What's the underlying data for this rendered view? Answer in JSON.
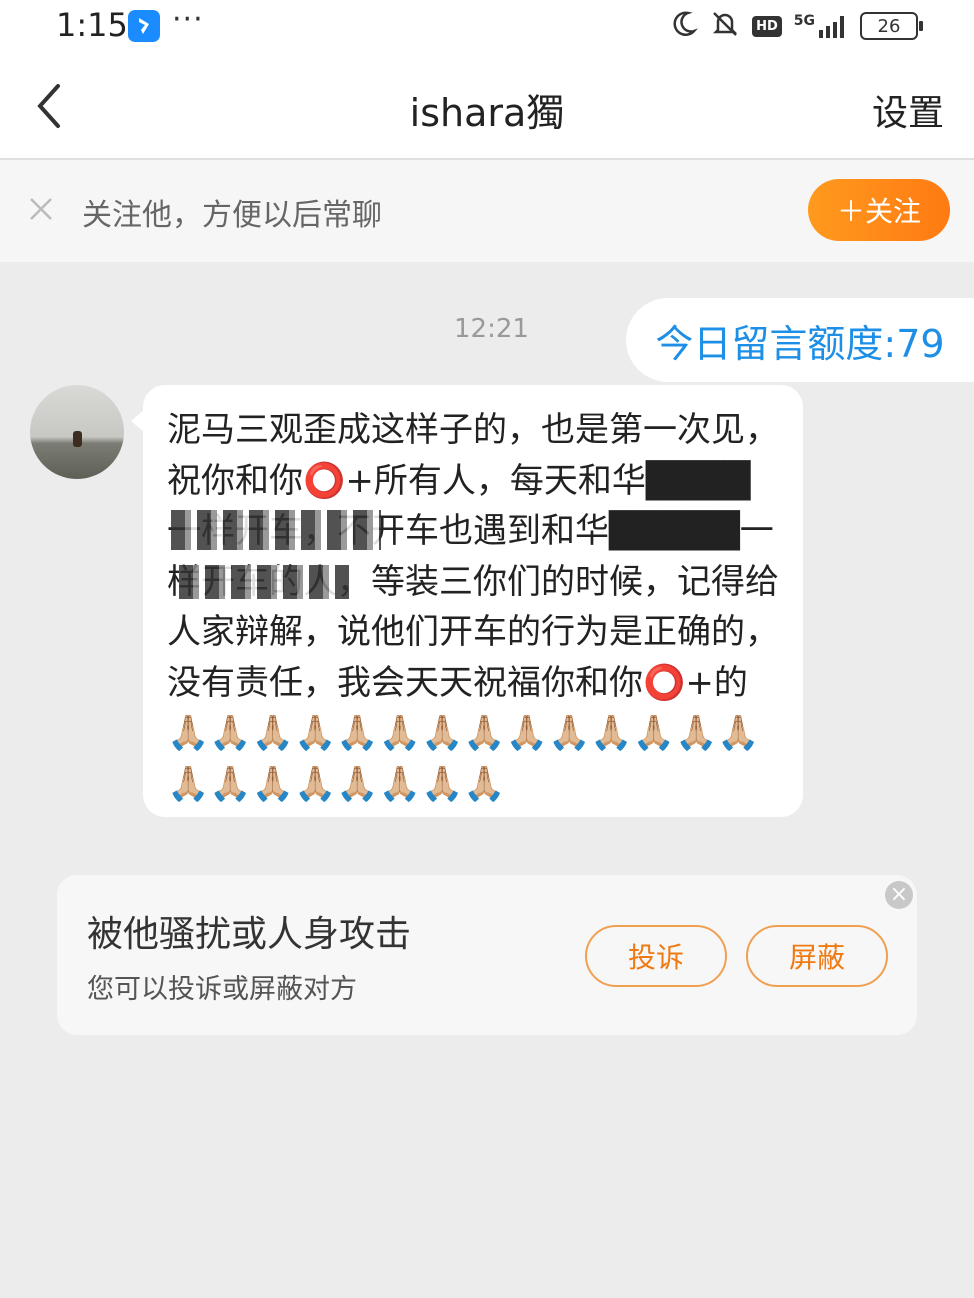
{
  "status_bar": {
    "time": "1:15",
    "dots": "···",
    "network": "5G",
    "hd": "HD",
    "battery": "26",
    "icons": [
      "app-icon",
      "moon-icon",
      "bell-muted-icon",
      "hd-icon",
      "signal-icon",
      "battery-icon"
    ]
  },
  "header": {
    "title": "ishara獨",
    "settings_label": "设置"
  },
  "follow_bar": {
    "text": "关注他，方便以后常聊",
    "button_label": "＋关注",
    "accent_color": "#ff8a18"
  },
  "chat": {
    "quota_text": "今日留言额度:79",
    "time": "12:21",
    "message": "泥马三观歪成这样子的，也是第一次见，祝你和你⭕+所有人，每天和华████一样开车，不开车也遇到和华█████一样开车的人，等装三你们的时候，记得给人家辩解，说他们开车的行为是正确的，没有责任，我会天天祝福你和你⭕+的🙏🏼🙏🏼🙏🏼🙏🏼🙏🏼🙏🏼🙏🏼🙏🏼🙏🏼🙏🏼🙏🏼🙏🏼🙏🏼🙏🏼🙏🏼🙏🏼🙏🏼🙏🏼🙏🏼🙏🏼🙏🏼🙏🏼"
  },
  "harassment_card": {
    "title": "被他骚扰或人身攻击",
    "subtitle": "您可以投诉或屏蔽对方",
    "report_label": "投诉",
    "block_label": "屏蔽",
    "close_symbol": "×"
  }
}
